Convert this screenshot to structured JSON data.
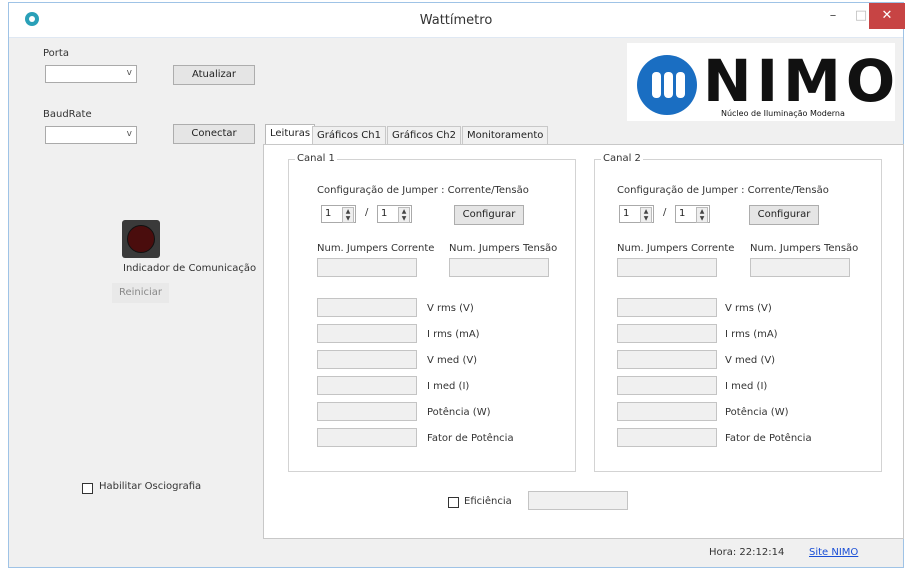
{
  "window": {
    "title": "Wattímetro",
    "minimize": "–",
    "maximize": "□",
    "close": "✕"
  },
  "left": {
    "porta_label": "Porta",
    "atualizar": "Atualizar",
    "baudrate_label": "BaudRate",
    "conectar": "Conectar",
    "indicador_label": "Indicador de Comunicação",
    "reiniciar": "Reiniciar",
    "habilitar_osc": "Habilitar Osciografia"
  },
  "logo": {
    "name": "NIMO",
    "subtitle": "Núcleo de Iluminação Moderna"
  },
  "tabs": [
    "Leituras",
    "Gráficos Ch1",
    "Gráficos Ch2",
    "Monitoramento"
  ],
  "channels": [
    {
      "title": "Canal 1",
      "config_label": "Configuração de Jumper :  Corrente/Tensão",
      "jumper_a": "1",
      "slash": "/",
      "jumper_b": "1",
      "configurar": "Configurar",
      "num_corrente": "Num. Jumpers Corrente",
      "num_tensao": "Num. Jumpers Tensão",
      "readings": [
        "V rms (V)",
        "I rms (mA)",
        "V med (V)",
        "I med (I)",
        "Potência (W)",
        "Fator de Potência"
      ]
    },
    {
      "title": "Canal 2",
      "config_label": "Configuração de Jumper :  Corrente/Tensão",
      "jumper_a": "1",
      "slash": "/",
      "jumper_b": "1",
      "configurar": "Configurar",
      "num_corrente": "Num. Jumpers Corrente",
      "num_tensao": "Num. Jumpers Tensão",
      "readings": [
        "V rms (V)",
        "I rms (mA)",
        "V med (V)",
        "I med (I)",
        "Potência (W)",
        "Fator de Potência"
      ]
    }
  ],
  "eficiencia_label": "Eficiência",
  "status": {
    "hora": "Hora: 22:12:14",
    "site": "Site NIMO"
  },
  "icons": {
    "combo_arrow": "chevron-down-icon",
    "spin": "spin-updown-icon"
  }
}
